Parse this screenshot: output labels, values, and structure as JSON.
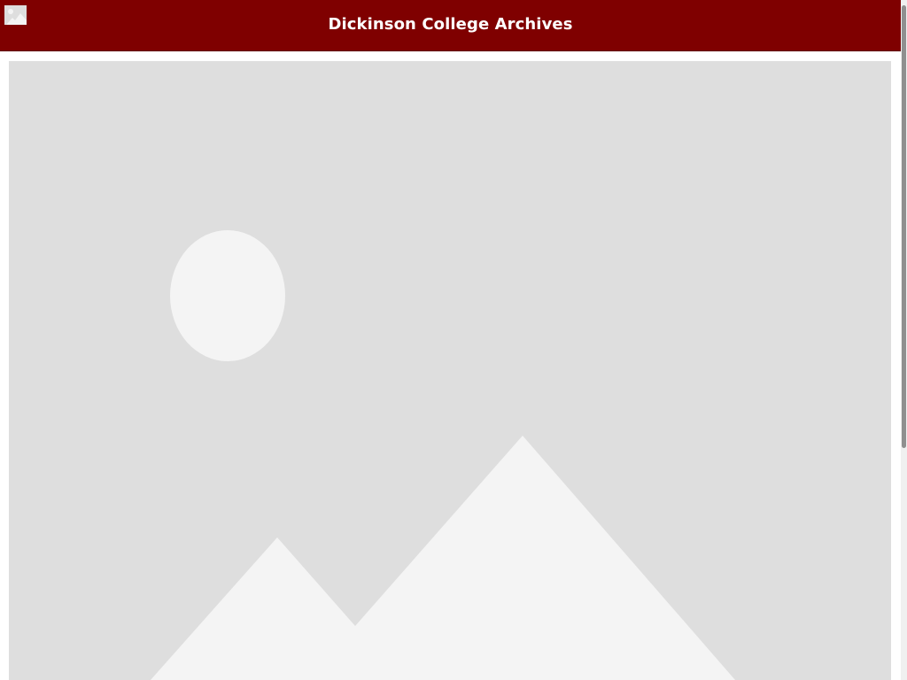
{
  "header": {
    "title": "Dickinson College Archives",
    "background_color": "#7f0000",
    "logo_icon": "image-placeholder-icon"
  },
  "main": {
    "image_icon": "image-placeholder-icon",
    "placeholder_color": "#dedede",
    "placeholder_shape_color": "#f4f4f4"
  },
  "scrollbar": {
    "orientation": "vertical"
  }
}
